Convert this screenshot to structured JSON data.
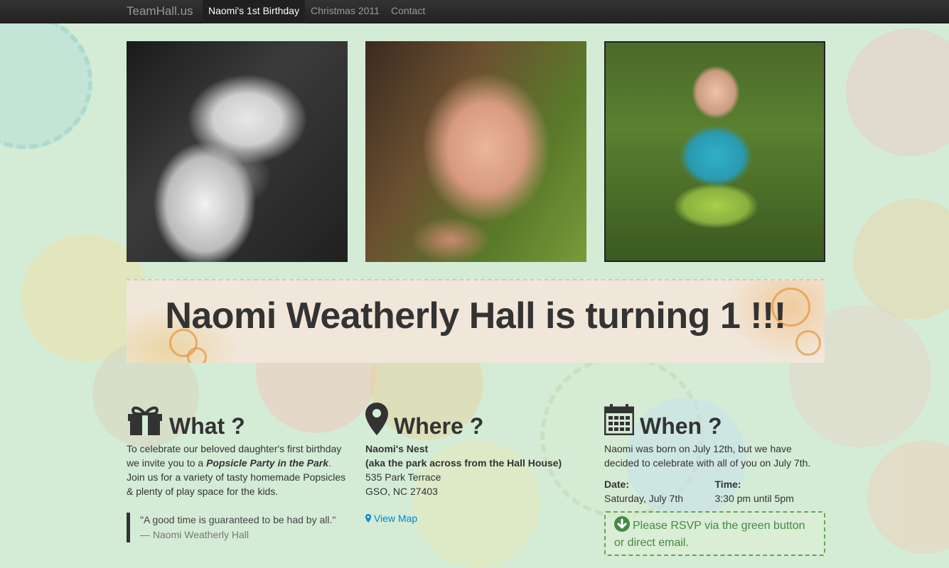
{
  "navbar": {
    "brand": "TeamHall.us",
    "items": [
      {
        "label": "Naomi's 1st Birthday",
        "active": true
      },
      {
        "label": "Christmas 2011",
        "active": false
      },
      {
        "label": "Contact",
        "active": false
      }
    ]
  },
  "banner": {
    "title": "Naomi Weatherly Hall is turning 1 !!!"
  },
  "what": {
    "heading": "What ?",
    "icon": "gift-icon",
    "text_before": "To celebrate our beloved daughter's first birthday we invite you to a ",
    "text_emphasis": "Popsicle Party in the Park",
    "text_after": ". Join us for a variety of tasty homemade Popsicles & plenty of play space for the kids.",
    "quote": "\"A good time is guaranteed to be had by all.\"",
    "quote_author": "— Naomi Weatherly Hall"
  },
  "where": {
    "heading": "Where ?",
    "icon": "map-marker-icon",
    "place_name": "Naomi's Nest",
    "place_note": "(aka the park across from the Hall House)",
    "address_line1": "535 Park Terrace",
    "address_line2": "GSO, NC 27403",
    "map_link": "View Map"
  },
  "when": {
    "heading": "When ?",
    "icon": "calendar-icon",
    "intro": "Naomi was born on July 12th, but we have decided to celebrate with all of you on July 7th.",
    "date_label": "Date:",
    "date_value": "Saturday, July 7th",
    "time_label": "Time:",
    "time_value": "3:30 pm until 5pm",
    "rsvp": "Please RSVP via the green button or direct email."
  },
  "colors": {
    "link": "#0088cc",
    "success": "#468847",
    "navbar": "#222222"
  }
}
